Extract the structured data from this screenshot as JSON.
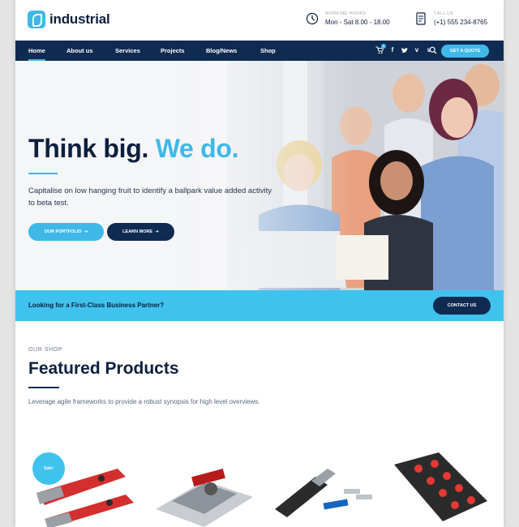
{
  "brand": {
    "name": "industrial",
    "accent": "#3fb8e8",
    "navy": "#0f2b52"
  },
  "header": {
    "hours_label": "WORKING HOURS",
    "hours_value": "Mon - Sat 8.00 - 18.00",
    "call_label": "CALL US",
    "call_value": "(+1) 555 234-8765"
  },
  "nav": {
    "items": [
      "Home",
      "About us",
      "Services",
      "Projects",
      "Blog/News",
      "Shop"
    ],
    "active": "Home",
    "cart_count": "0",
    "quote_label": "GET A QUOTE",
    "icons": [
      "cart-icon",
      "facebook-icon",
      "twitter-icon",
      "vine-icon",
      "vimeo-icon",
      "search-icon"
    ]
  },
  "hero": {
    "title_a": "Think big.",
    "title_b": "We do.",
    "text": "Capitalise on low hanging fruit to identify a ballpark value added activity to beta test.",
    "btn_portfolio": "OUR PORTFOLIO",
    "btn_learn": "LEARN MORE"
  },
  "cta": {
    "text": "Looking for a First-Class Business Partner?",
    "button": "CONTACT US"
  },
  "shop": {
    "eyebrow": "OUR SHOP",
    "title": "Featured Products",
    "text": "Leverage agile frameworks to provide a robust synopsis for high level overviews.",
    "sale_badge": "Sale!",
    "products": [
      "utility-knives-product",
      "tile-cutter-product",
      "box-cutter-product",
      "socket-set-product"
    ]
  }
}
